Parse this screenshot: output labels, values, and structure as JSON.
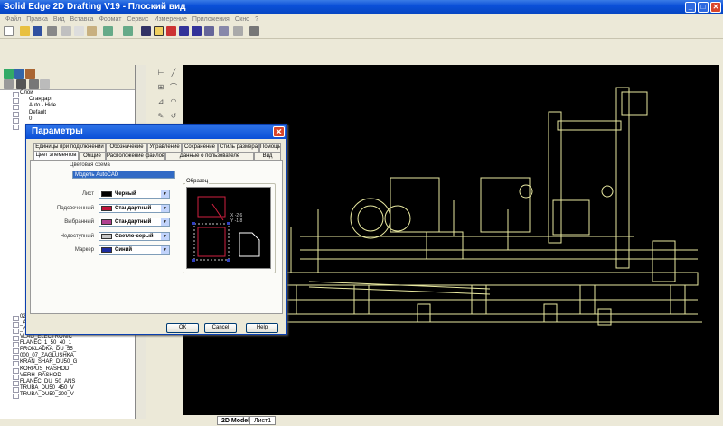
{
  "window": {
    "title": "Solid Edge 2D Drafting V19 - Плоский вид",
    "min": "_",
    "max": "□",
    "close": "✕"
  },
  "menu": [
    "Файл",
    "Правка",
    "Вид",
    "Вставка",
    "Формат",
    "Сервис",
    "Измерение",
    "Приложения",
    "Окно",
    "?"
  ],
  "left_pane": {
    "layers_root": "Слои",
    "layers": [
      "Стандарт",
      "Auto - Hide",
      "Default",
      "0"
    ],
    "files": [
      "024_05_SHPILKA",
      "_A_KA_14__OCT_11",
      "_A_KA_14__OCT_5",
      "VLAG_ELECTRONIC",
      "FLANEC_1_50_40_1",
      "PROKLADKA_DU_55_",
      "000_07_ZAGLUSHKA",
      "KRAN_SHAR_DU50_G",
      "KORPUS_RASHOD",
      "VERH_RASHOD",
      "FLANEC_DU_50_ANS",
      "TRUBA_DU50_450_V",
      "TRUBA_DU50_200_V"
    ]
  },
  "sheet_tabs": [
    "2D Model",
    "Лист1"
  ],
  "dialog": {
    "title": "Параметры",
    "tabs_row1": [
      "Единицы при подключении",
      "Обозначение",
      "Управление",
      "Сохранение",
      "Стиль размера",
      "Помощь"
    ],
    "tabs_row2": [
      "Цвет элементов",
      "Общие",
      "Расположение файлов",
      "Данные о пользователе",
      "Вид"
    ],
    "scheme_label": "Цветовая схема",
    "scheme_value": "Модель AutoCAD",
    "rows": [
      {
        "label": "Лист",
        "value": "Черный",
        "color": "#000000"
      },
      {
        "label": "Подсвеченный",
        "value": "Стандартный",
        "color": "#c0143c"
      },
      {
        "label": "Выбранный",
        "value": "Стандартный",
        "color": "#b04090"
      },
      {
        "label": "Недоступный",
        "value": "Светло-серый",
        "color": "#c8c8c8"
      },
      {
        "label": "Маркер",
        "value": "Синий",
        "color": "#1c2ca0"
      }
    ],
    "preview_label": "Образец",
    "preview_readout": "X -2.6\nY -1.8",
    "buttons": {
      "ok": "ОК",
      "cancel": "Cancel",
      "help": "Help"
    }
  },
  "colors": {
    "drawing": "#e8e8a0",
    "canvas": "#000000",
    "titlebar": "#0a4fd8"
  }
}
